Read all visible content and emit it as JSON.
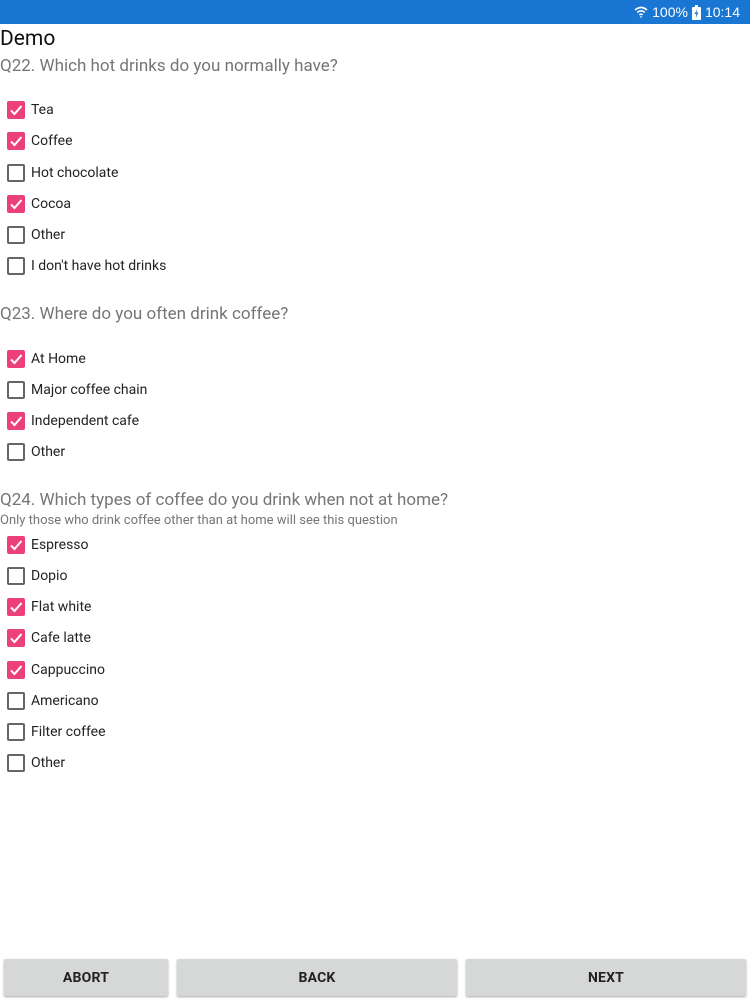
{
  "status_bar": {
    "battery_percent": "100%",
    "time": "10:14",
    "bg_color": "#1976d2",
    "icons": [
      "wifi-icon",
      "battery-icon"
    ]
  },
  "page": {
    "title": "Demo"
  },
  "accent_color": "#ec407a",
  "questions": [
    {
      "title": "Q22. Which hot drinks do you normally have?",
      "note": "",
      "options": [
        {
          "label": "Tea",
          "checked": true
        },
        {
          "label": "Coffee",
          "checked": true
        },
        {
          "label": "Hot chocolate",
          "checked": false
        },
        {
          "label": "Cocoa",
          "checked": true
        },
        {
          "label": "Other",
          "checked": false
        },
        {
          "label": "I don't have hot drinks",
          "checked": false
        }
      ]
    },
    {
      "title": "Q23. Where do you often drink coffee?",
      "note": "",
      "options": [
        {
          "label": "At Home",
          "checked": true
        },
        {
          "label": "Major coffee chain",
          "checked": false
        },
        {
          "label": "Independent cafe",
          "checked": true
        },
        {
          "label": "Other",
          "checked": false
        }
      ]
    },
    {
      "title": "Q24. Which types of coffee do you drink when not at home?",
      "note": "Only those who drink coffee other than at home will see this question",
      "options": [
        {
          "label": "Espresso",
          "checked": true
        },
        {
          "label": "Dopio",
          "checked": false
        },
        {
          "label": "Flat white",
          "checked": true
        },
        {
          "label": "Cafe latte",
          "checked": true
        },
        {
          "label": "Cappuccino",
          "checked": true
        },
        {
          "label": "Americano",
          "checked": false
        },
        {
          "label": "Filter coffee",
          "checked": false
        },
        {
          "label": "Other",
          "checked": false
        }
      ]
    }
  ],
  "buttons": {
    "abort": "ABORT",
    "back": "BACK",
    "next": "NEXT"
  }
}
